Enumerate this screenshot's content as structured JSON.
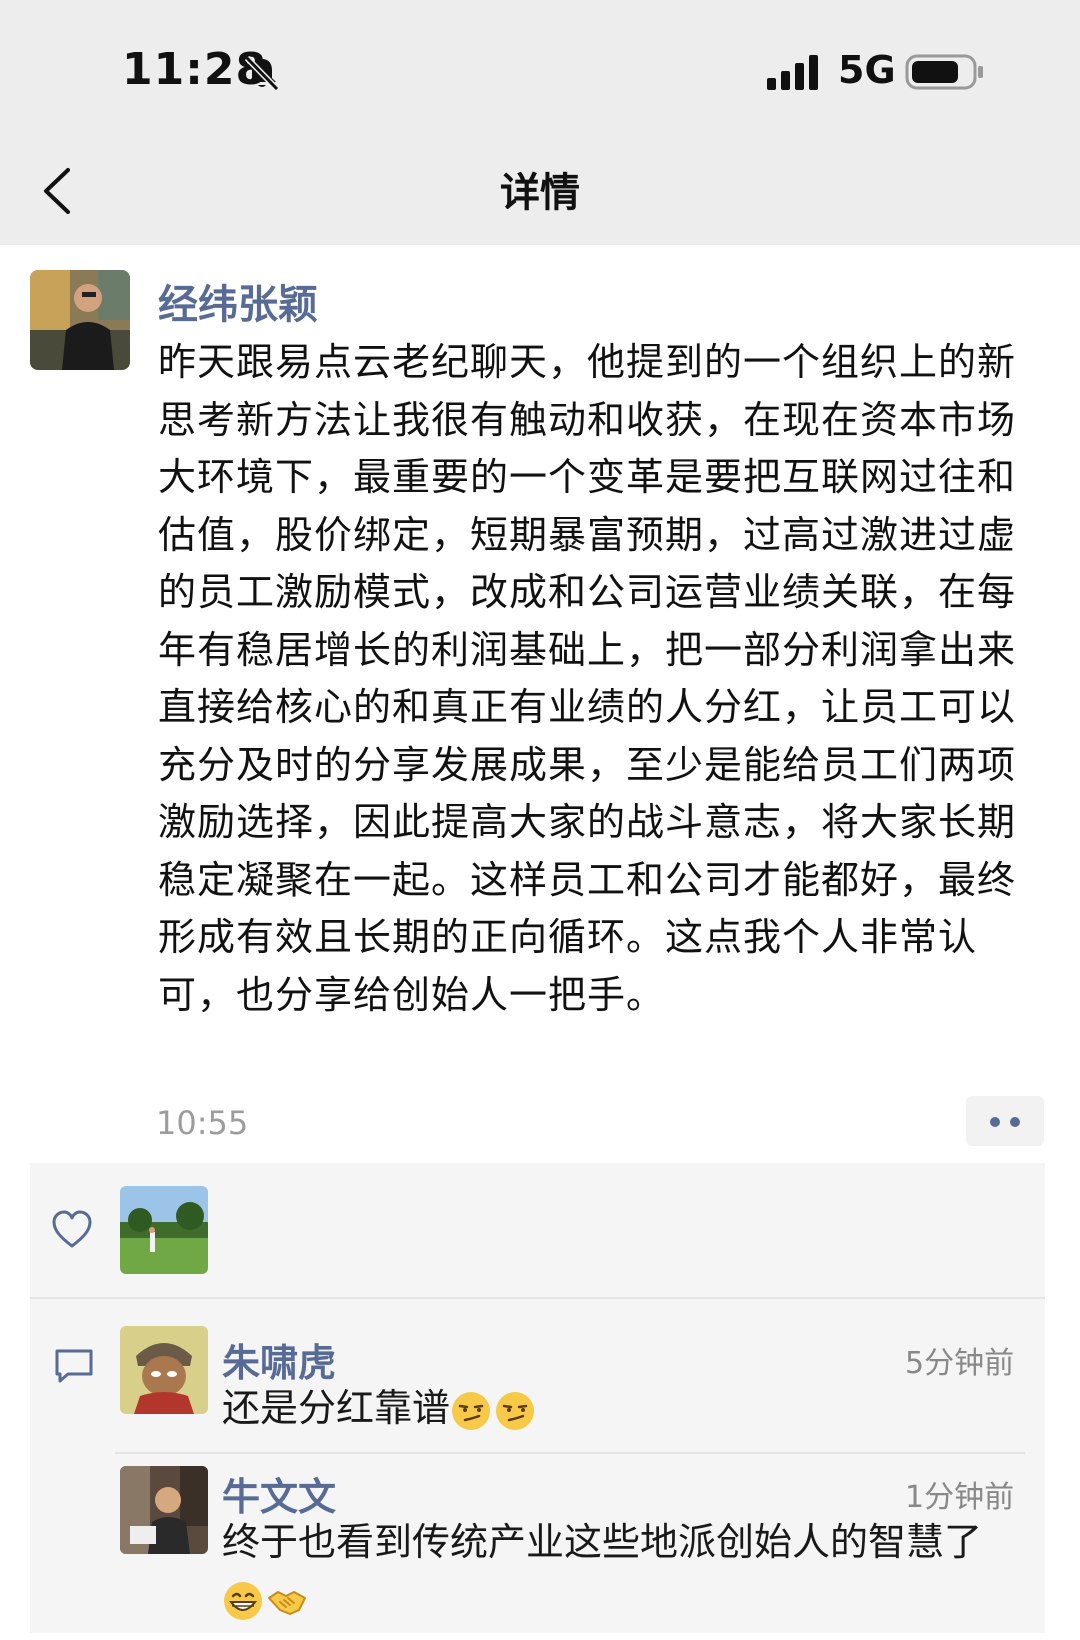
{
  "status_bar": {
    "time": "11:28",
    "network": "5G",
    "icons": [
      "bell-slash-icon",
      "signal-bars-icon",
      "battery-icon"
    ]
  },
  "nav": {
    "title": "详情",
    "back_icon": "chevron-left-icon"
  },
  "post": {
    "author": "经纬张颖",
    "content": "昨天跟易点云老纪聊天，他提到的一个组织上的新思考新方法让我很有触动和收获，在现在资本市场大环境下，最重要的一个变革是要把互联网过往和估值，股价绑定，短期暴富预期，过高过激进过虚的员工激励模式，改成和公司运营业绩关联，在每年有稳居增长的利润基础上，把一部分利润拿出来直接给核心的和真正有业绩的人分红，让员工可以充分及时的分享发展成果，至少是能给员工们两项激励选择，因此提高大家的战斗意志，将大家长期稳定凝聚在一起。这样员工和公司才能都好，最终形成有效且长期的正向循环。这点我个人非常认可，也分享给创始人一把手。",
    "time": "10:55"
  },
  "likes": {
    "icon": "heart-outline-icon"
  },
  "comments": {
    "icon": "comment-bubble-icon",
    "items": [
      {
        "name": "朱啸虎",
        "time": "5分钟前",
        "text": "还是分红靠谱",
        "emojis": [
          "smirk-emoji",
          "smirk-emoji"
        ]
      },
      {
        "name": "牛文文",
        "time": "1分钟前",
        "text": "终于也看到传统产业这些地派创始人的智慧了",
        "emojis": [
          "grin-emoji",
          "handshake-emoji"
        ]
      }
    ]
  },
  "colors": {
    "link_blue": "#576b95",
    "header_bg": "#ededed",
    "panel_bg": "#f5f5f5"
  }
}
